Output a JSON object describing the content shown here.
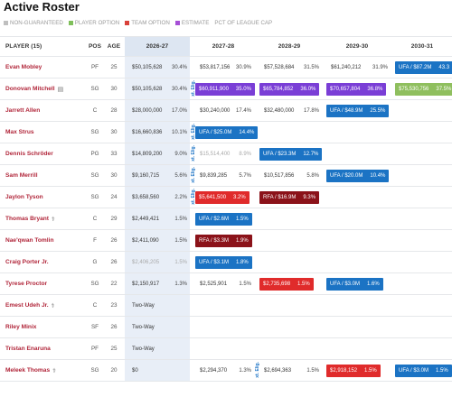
{
  "title": "Active Roster",
  "legend": [
    {
      "label": "NON-GUARANTEED",
      "color": "#bfbfbf"
    },
    {
      "label": "PLAYER OPTION",
      "color": "#7fbf5a"
    },
    {
      "label": "TEAM OPTION",
      "color": "#d9413a"
    },
    {
      "label": "ESTIMATE",
      "color": "#a64fd6"
    },
    {
      "label": "PCT OF LEAGUE CAP",
      "color": ""
    }
  ],
  "columns": {
    "player": "PLAYER (15)",
    "pos": "POS",
    "age": "AGE",
    "y1": "2026-27",
    "y2": "2027-28",
    "y3": "2028-29",
    "y4": "2029-30",
    "y5": "2030-31"
  },
  "colors": {
    "ufa": "#1b73c4",
    "rfa": "#8b1219",
    "team_option": "#e02b2b",
    "estimate": "#7a3ed6",
    "player_option": "#8fbf5e",
    "pct_badge": "#0f3d6b"
  },
  "elig_label": "xt. Elig.",
  "rows": [
    {
      "name": "Evan Mobley",
      "pos": "PF",
      "age": "25",
      "y1": {
        "amt": "$50,105,628",
        "pct": "30.4%"
      },
      "y2": {
        "amt": "$53,817,156",
        "pct": "30.9%"
      },
      "y3": {
        "amt": "$57,528,684",
        "pct": "31.5%"
      },
      "y4": {
        "amt": "$61,240,212",
        "pct": "31.9%"
      },
      "y5": {
        "pill": "UFA / $87.2M",
        "pp": "43.3",
        "style": "ufa"
      }
    },
    {
      "name": "Donovan Mitchell",
      "icon": "▤",
      "pos": "SG",
      "age": "30",
      "elig": true,
      "y1": {
        "amt": "$50,105,628",
        "pct": "30.4%"
      },
      "y2": {
        "pill": "$60,911,900",
        "pp": "35.0%",
        "style": "estimate"
      },
      "y3": {
        "pill": "$65,784,852",
        "pp": "36.0%",
        "style": "estimate"
      },
      "y4": {
        "pill": "$70,657,804",
        "pp": "36.8%",
        "style": "estimate"
      },
      "y5": {
        "pill": "$75,530,756",
        "pp": "37.5%",
        "style": "player_option"
      }
    },
    {
      "name": "Jarrett Allen",
      "pos": "C",
      "age": "28",
      "y1": {
        "amt": "$28,000,000",
        "pct": "17.0%"
      },
      "y2": {
        "amt": "$30,240,000",
        "pct": "17.4%"
      },
      "y3": {
        "amt": "$32,480,000",
        "pct": "17.8%"
      },
      "y4": {
        "pill": "UFA / $48.9M",
        "pp": "25.5%",
        "style": "ufa"
      },
      "y5": {}
    },
    {
      "name": "Max Strus",
      "pos": "SG",
      "age": "30",
      "elig": true,
      "y1": {
        "amt": "$16,660,836",
        "pct": "10.1%"
      },
      "y2": {
        "pill": "UFA / $25.0M",
        "pp": "14.4%",
        "style": "ufa"
      },
      "y3": {},
      "y4": {},
      "y5": {}
    },
    {
      "name": "Dennis Schröder",
      "pos": "PG",
      "age": "33",
      "elig": true,
      "y1": {
        "amt": "$14,809,200",
        "pct": "9.0%"
      },
      "y2": {
        "amt": "$15,514,400",
        "pct": "8.9%",
        "gray": true
      },
      "y3": {
        "pill": "UFA / $23.3M",
        "pp": "12.7%",
        "style": "ufa"
      },
      "y4": {},
      "y5": {}
    },
    {
      "name": "Sam Merrill",
      "pos": "SG",
      "age": "30",
      "elig": true,
      "y1": {
        "amt": "$9,160,715",
        "pct": "5.6%"
      },
      "y2": {
        "amt": "$9,839,285",
        "pct": "5.7%"
      },
      "y3": {
        "amt": "$10,517,856",
        "pct": "5.8%"
      },
      "y4": {
        "pill": "UFA / $20.0M",
        "pp": "10.4%",
        "style": "ufa"
      },
      "y5": {}
    },
    {
      "name": "Jaylon Tyson",
      "pos": "SG",
      "age": "24",
      "elig": true,
      "y1": {
        "amt": "$3,658,560",
        "pct": "2.2%"
      },
      "y2": {
        "pill": "$5,641,500",
        "pp": "3.2%",
        "style": "team_option"
      },
      "y3": {
        "pill": "RFA / $16.9M",
        "pp": "9.3%",
        "style": "rfa"
      },
      "y4": {},
      "y5": {}
    },
    {
      "name": "Thomas Bryant",
      "icon": "⚕",
      "pos": "C",
      "age": "29",
      "y1": {
        "amt": "$2,449,421",
        "pct": "1.5%"
      },
      "y2": {
        "pill": "UFA / $2.6M",
        "pp": "1.5%",
        "style": "ufa"
      },
      "y3": {},
      "y4": {},
      "y5": {}
    },
    {
      "name": "Nae'qwan Tomlin",
      "pos": "F",
      "age": "26",
      "y1": {
        "amt": "$2,411,090",
        "pct": "1.5%"
      },
      "y2": {
        "pill": "RFA / $3.3M",
        "pp": "1.9%",
        "style": "rfa"
      },
      "y3": {},
      "y4": {},
      "y5": {}
    },
    {
      "name": "Craig Porter Jr.",
      "pos": "G",
      "age": "26",
      "y1": {
        "amt": "$2,406,205",
        "pct": "1.5%",
        "gray": true
      },
      "y2": {
        "pill": "UFA / $3.1M",
        "pp": "1.8%",
        "style": "ufa"
      },
      "y3": {},
      "y4": {},
      "y5": {}
    },
    {
      "name": "Tyrese Proctor",
      "pos": "SG",
      "age": "22",
      "y1": {
        "amt": "$2,150,917",
        "pct": "1.3%"
      },
      "y2": {
        "amt": "$2,525,901",
        "pct": "1.5%"
      },
      "y3": {
        "pill": "$2,735,698",
        "pp": "1.5%",
        "style": "team_option"
      },
      "y4": {
        "pill": "UFA / $3.0M",
        "pp": "1.6%",
        "style": "ufa"
      },
      "y5": {}
    },
    {
      "name": "Emest Udeh Jr.",
      "icon": "⚕",
      "pos": "C",
      "age": "23",
      "y1": {
        "twoway": "Two-Way"
      },
      "y2": {},
      "y3": {},
      "y4": {},
      "y5": {}
    },
    {
      "name": "Riley Minix",
      "pos": "SF",
      "age": "26",
      "y1": {
        "twoway": "Two-Way"
      },
      "y2": {},
      "y3": {},
      "y4": {},
      "y5": {}
    },
    {
      "name": "Tristan Enaruna",
      "pos": "PF",
      "age": "25",
      "y1": {
        "twoway": "Two-Way"
      },
      "y2": {},
      "y3": {},
      "y4": {},
      "y5": {}
    },
    {
      "name": "Meleek Thomas",
      "icon": "⚕",
      "pos": "SG",
      "age": "20",
      "elig3": true,
      "y1": {
        "amt": "$0",
        "pct": ""
      },
      "y2": {
        "amt": "$2,294,370",
        "pct": "1.3%"
      },
      "y3": {
        "amt": "$2,694,363",
        "pct": "1.5%"
      },
      "y4": {
        "pill": "$2,918,152",
        "pp": "1.5%",
        "style": "team_option"
      },
      "y5": {
        "pill": "UFA / $3.0M",
        "pp": "1.5%",
        "style": "ufa"
      }
    }
  ]
}
